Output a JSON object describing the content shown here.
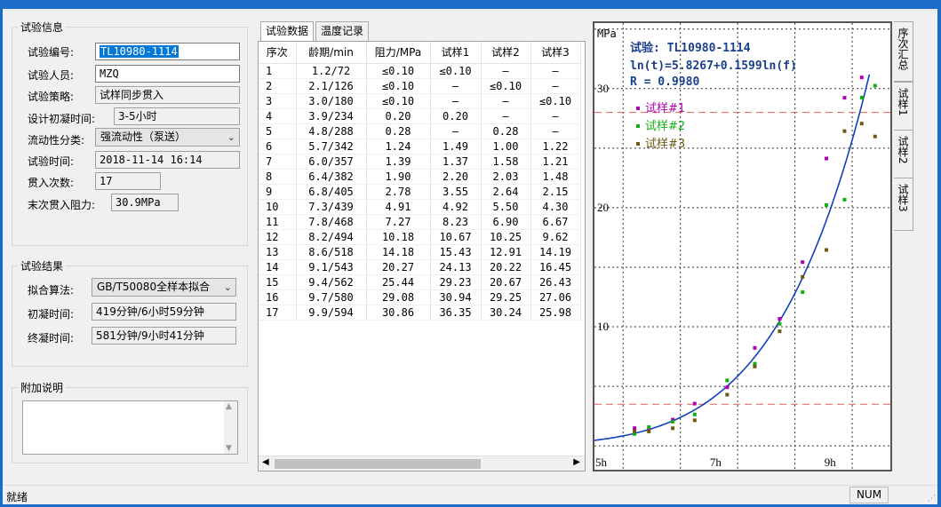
{
  "test_info": {
    "title": "试验信息",
    "fields": {
      "test_no": {
        "label": "试验编号:",
        "value": "TL10980-1114"
      },
      "tester": {
        "label": "试验人员:",
        "value": "MZQ"
      },
      "strategy": {
        "label": "试验策略:",
        "value": "试样同步贯入"
      },
      "design_time": {
        "label": "设计初凝时间:",
        "value": "3-5小时"
      },
      "fluidity": {
        "label": "流动性分类:",
        "value": "强流动性（泵送）"
      },
      "test_time": {
        "label": "试验时间:",
        "value": "2018-11-14 16:14"
      },
      "count": {
        "label": "贯入次数:",
        "value": "17"
      },
      "last_resist": {
        "label": "末次贯入阻力:",
        "value": "30.9MPa"
      }
    }
  },
  "test_result": {
    "title": "试验结果",
    "fields": {
      "algo": {
        "label": "拟合算法:",
        "value": "GB/T50080全样本拟合"
      },
      "initial": {
        "label": "初凝时间:",
        "value": "419分钟/6小时59分钟"
      },
      "final": {
        "label": "终凝时间:",
        "value": "581分钟/9小时41分钟"
      }
    }
  },
  "note": {
    "title": "附加说明",
    "value": ""
  },
  "tabs": [
    "试验数据",
    "温度记录"
  ],
  "table": {
    "headers": [
      "序次",
      "龄期/min",
      "阻力/MPa",
      "试样1",
      "试样2",
      "试样3"
    ],
    "rows": [
      [
        "1",
        "1.2/72",
        "≤0.10",
        "≤0.10",
        "—",
        "—"
      ],
      [
        "2",
        "2.1/126",
        "≤0.10",
        "—",
        "≤0.10",
        "—"
      ],
      [
        "3",
        "3.0/180",
        "≤0.10",
        "—",
        "—",
        "≤0.10"
      ],
      [
        "4",
        "3.9/234",
        "0.20",
        "0.20",
        "—",
        "—"
      ],
      [
        "5",
        "4.8/288",
        "0.28",
        "—",
        "0.28",
        "—"
      ],
      [
        "6",
        "5.7/342",
        "1.24",
        "1.49",
        "1.00",
        "1.22"
      ],
      [
        "7",
        "6.0/357",
        "1.39",
        "1.37",
        "1.58",
        "1.21"
      ],
      [
        "8",
        "6.4/382",
        "1.90",
        "2.20",
        "2.03",
        "1.48"
      ],
      [
        "9",
        "6.8/405",
        "2.78",
        "3.55",
        "2.64",
        "2.15"
      ],
      [
        "10",
        "7.3/439",
        "4.91",
        "4.92",
        "5.50",
        "4.30"
      ],
      [
        "11",
        "7.8/468",
        "7.27",
        "8.23",
        "6.90",
        "6.67"
      ],
      [
        "12",
        "8.2/494",
        "10.18",
        "10.67",
        "10.25",
        "9.62"
      ],
      [
        "13",
        "8.6/518",
        "14.18",
        "15.43",
        "12.91",
        "14.19"
      ],
      [
        "14",
        "9.1/543",
        "20.27",
        "24.13",
        "20.22",
        "16.45"
      ],
      [
        "15",
        "9.4/562",
        "25.44",
        "29.23",
        "20.67",
        "26.43"
      ],
      [
        "16",
        "9.7/580",
        "29.08",
        "30.94",
        "29.25",
        "27.06"
      ],
      [
        "17",
        "9.9/594",
        "30.86",
        "36.35",
        "30.24",
        "25.98"
      ]
    ]
  },
  "chart_data": {
    "type": "scatter",
    "title": "试验: TL10980-1114",
    "equation": "ln(t)=5.8267+0.1599ln(f)",
    "r_text": "R = 0.9980",
    "ylabel": "MPa",
    "x_ticks": [
      "5h",
      "7h",
      "9h"
    ],
    "y_ticks": [
      "10",
      "20",
      "30"
    ],
    "xlim": [
      300,
      610
    ],
    "ylim": [
      -2,
      35.5
    ],
    "ref_lines": [
      3.5,
      28
    ],
    "fit": {
      "a": 5.8267,
      "b": 0.1599
    },
    "series": [
      {
        "name": "试样#1",
        "color": "#b000b0",
        "x": [
          342,
          357,
          382,
          405,
          439,
          468,
          494,
          518,
          543,
          562,
          580,
          594
        ],
        "y": [
          1.49,
          1.37,
          2.2,
          3.55,
          4.92,
          8.23,
          10.67,
          15.43,
          24.13,
          29.23,
          30.94,
          36.35
        ]
      },
      {
        "name": "试样#2",
        "color": "#10b010",
        "x": [
          288,
          342,
          357,
          382,
          405,
          439,
          468,
          494,
          518,
          543,
          562,
          580,
          594
        ],
        "y": [
          0.28,
          1.0,
          1.58,
          2.03,
          2.64,
          5.5,
          6.9,
          10.25,
          12.91,
          20.22,
          20.67,
          29.25,
          30.24
        ]
      },
      {
        "name": "试样#3",
        "color": "#6b5a10",
        "x": [
          342,
          357,
          382,
          405,
          439,
          468,
          494,
          518,
          543,
          562,
          580,
          594
        ],
        "y": [
          1.22,
          1.21,
          1.48,
          2.15,
          4.3,
          6.67,
          9.62,
          14.19,
          16.45,
          26.43,
          27.06,
          25.98
        ]
      }
    ],
    "fit_color": "#1040c0",
    "ref_color": "#e06060",
    "grid_color": "#333333"
  },
  "side_tabs": [
    "序次汇总",
    "试样1",
    "试样2",
    "试样3"
  ],
  "status": {
    "left": "就绪",
    "num": "NUM"
  }
}
